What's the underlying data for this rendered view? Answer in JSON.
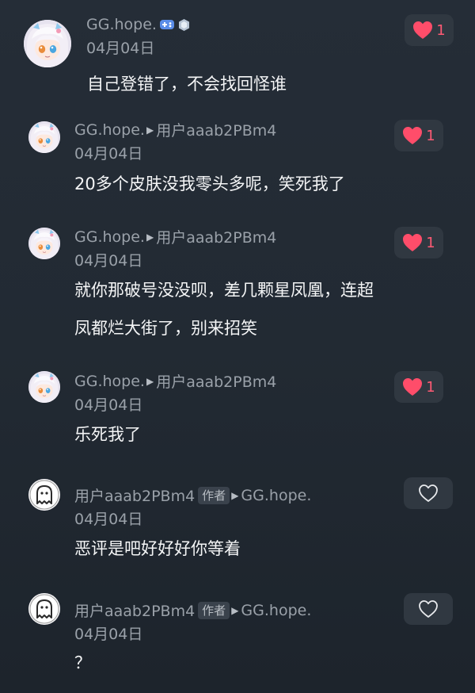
{
  "colors": {
    "background": "#232a33",
    "like_active": "#ff4d6a",
    "muted_text": "#9aa1a9",
    "button_bg": "#303841"
  },
  "comments": [
    {
      "user": "GG.hope.",
      "date": "04月04日",
      "text": "自己登错了，不会找回怪谁",
      "likes": "1",
      "liked": true,
      "avatar_icon": "anime-girl-avatar",
      "badges": [
        "game-controller-icon",
        "level-badge-icon"
      ]
    },
    {
      "user": "GG.hope.",
      "reply_to": "用户aaab2PBm4",
      "date": "04月04日",
      "text": "20多个皮肤没我零头多呢，笑死我了",
      "likes": "1",
      "liked": true,
      "avatar_icon": "anime-girl-avatar"
    },
    {
      "user": "GG.hope.",
      "reply_to": "用户aaab2PBm4",
      "date": "04月04日",
      "text_line1": "就你那破号没没呗，差几颗星凤凰，连超",
      "text_line2": "凤都烂大街了，别来招笑",
      "likes": "1",
      "liked": true,
      "avatar_icon": "anime-girl-avatar"
    },
    {
      "user": "GG.hope.",
      "reply_to": "用户aaab2PBm4",
      "date": "04月04日",
      "text": "乐死我了",
      "likes": "1",
      "liked": true,
      "avatar_icon": "anime-girl-avatar"
    },
    {
      "user": "用户aaab2PBm4",
      "author_tag": "作者",
      "reply_to": "GG.hope.",
      "date": "04月04日",
      "text": "恶评是吧好好好你等着",
      "liked": false,
      "avatar_icon": "ghost-avatar"
    },
    {
      "user": "用户aaab2PBm4",
      "author_tag": "作者",
      "reply_to": "GG.hope.",
      "date": "04月04日",
      "text": "？",
      "liked": false,
      "avatar_icon": "ghost-avatar"
    }
  ]
}
